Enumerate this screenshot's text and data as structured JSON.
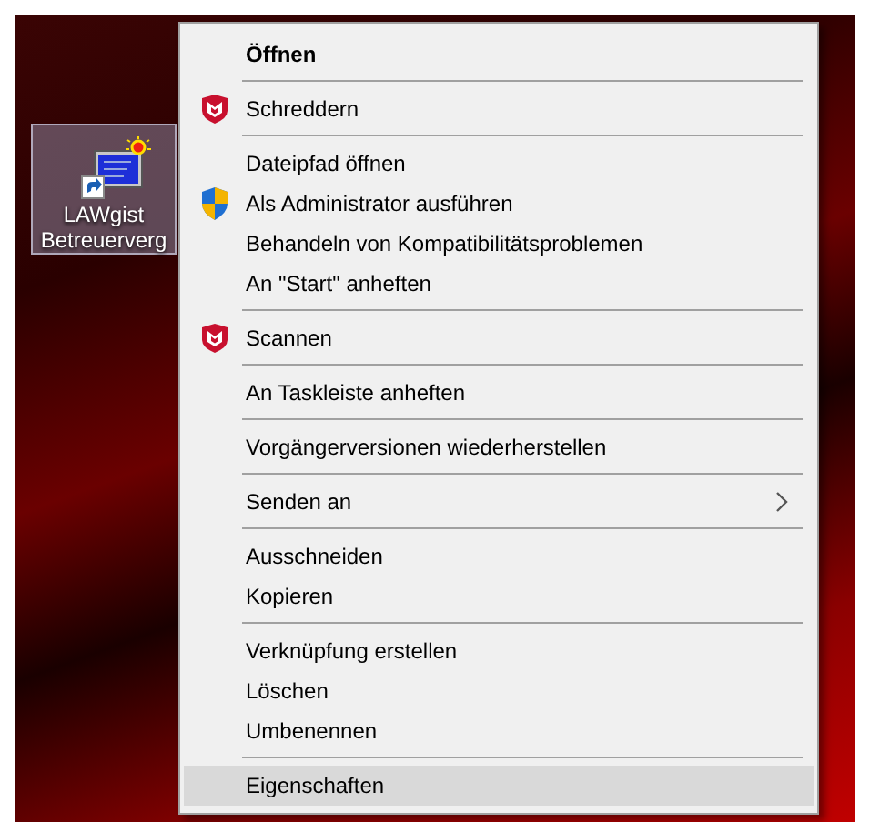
{
  "desktop_icon": {
    "label_lines": [
      "LAWgist",
      "Betreuerverg"
    ],
    "selected": true
  },
  "context_menu": {
    "items": [
      {
        "kind": "item",
        "label": "Öffnen",
        "default": true,
        "selected": false
      },
      {
        "kind": "separator"
      },
      {
        "kind": "antivirus",
        "label": "Schreddern",
        "selected": false
      },
      {
        "kind": "separator"
      },
      {
        "kind": "item",
        "label": "Dateipfad öffnen",
        "selected": false
      },
      {
        "kind": "admin",
        "label": "Als Administrator ausführen",
        "selected": false
      },
      {
        "kind": "item",
        "label": "Behandeln von Kompatibilitätsproblemen",
        "selected": false
      },
      {
        "kind": "item",
        "label": "An \"Start\" anheften",
        "selected": false
      },
      {
        "kind": "separator"
      },
      {
        "kind": "antivirus",
        "label": "Scannen",
        "selected": false
      },
      {
        "kind": "separator"
      },
      {
        "kind": "item",
        "label": "An Taskleiste anheften",
        "selected": false
      },
      {
        "kind": "separator"
      },
      {
        "kind": "item",
        "label": "Vorgängerversionen wiederherstellen",
        "selected": false
      },
      {
        "kind": "separator"
      },
      {
        "kind": "item",
        "label": "Senden an",
        "submenu": true,
        "selected": false
      },
      {
        "kind": "separator"
      },
      {
        "kind": "item",
        "label": "Ausschneiden",
        "selected": false
      },
      {
        "kind": "item",
        "label": "Kopieren",
        "selected": false
      },
      {
        "kind": "separator"
      },
      {
        "kind": "item",
        "label": "Verknüpfung erstellen",
        "selected": false
      },
      {
        "kind": "item",
        "label": "Löschen",
        "selected": false
      },
      {
        "kind": "item",
        "label": "Umbenennen",
        "selected": false
      },
      {
        "kind": "separator"
      },
      {
        "kind": "item",
        "label": "Eigenschaften",
        "selected": true
      }
    ]
  }
}
